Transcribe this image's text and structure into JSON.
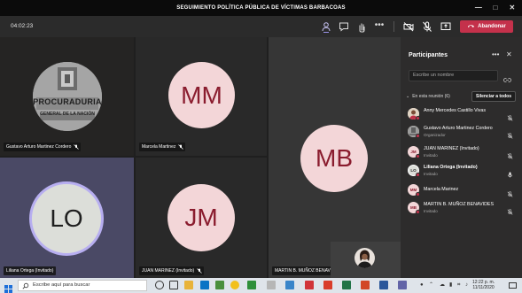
{
  "window": {
    "title": "SEGUIMIENTO POLÍTICA PÚBLICA DE VÍCTIMAS BARBACOAS"
  },
  "toolbar": {
    "timer": "04:02:23",
    "leave_label": "Abandonar"
  },
  "tiles": [
    {
      "label": "Gustavo Arturo Martinez Cordero",
      "type": "photo",
      "photo_text_top": "PROCURADURIA",
      "photo_text_bottom": "GENERAL DE LA NACIÓN"
    },
    {
      "label": "Marcela Martinez",
      "initials": "MM",
      "type": "initials"
    },
    {
      "label": "MARTIN B. MUÑOZ BENAVIDES",
      "initials": "MB",
      "type": "initials"
    },
    {
      "label": "Liliana Ortega (Invitado)",
      "initials": "LO",
      "type": "initials-speaking"
    },
    {
      "label": "JUAN MARINEZ (Invitado)",
      "initials": "JM",
      "type": "initials"
    }
  ],
  "panel": {
    "title": "Participantes",
    "search_placeholder": "Escribe un nombre",
    "section_label": "En esta reunión (6)",
    "mute_all_label": "Silenciar a todos",
    "participants": [
      {
        "name": "Anny Mercedes Castillo Vivas",
        "subtitle": "",
        "initials": "",
        "avatar": "photo",
        "mic": "off"
      },
      {
        "name": "Gustavo Arturo Martinez Cordero",
        "subtitle": "Organizador",
        "initials": "",
        "avatar": "photo",
        "mic": "off"
      },
      {
        "name": "JUAN MARINEZ (Invitado)",
        "subtitle": "Invitado",
        "initials": "JM",
        "avatar": "initials",
        "mic": "off"
      },
      {
        "name": "Liliana Ortega (Invitado)",
        "subtitle": "Invitado",
        "initials": "LO",
        "avatar": "initials-dark",
        "mic": "on"
      },
      {
        "name": "Marcela Marinez",
        "subtitle": "",
        "initials": "MM",
        "avatar": "initials",
        "mic": "off"
      },
      {
        "name": "MARTIN B. MUÑOZ BENAVIDES",
        "subtitle": "Invitado",
        "initials": "MB",
        "avatar": "initials",
        "mic": "off"
      }
    ]
  },
  "taskbar": {
    "search_placeholder": "Escribe aquí para buscar",
    "time": "12:22 p. m.",
    "date": "11/11/2020"
  },
  "colors": {
    "avatar_bg": "#f3d6d8",
    "avatar_text": "#8a1c2e",
    "leave_button": "#c4314b",
    "speaking_ring": "#b7aef0"
  }
}
